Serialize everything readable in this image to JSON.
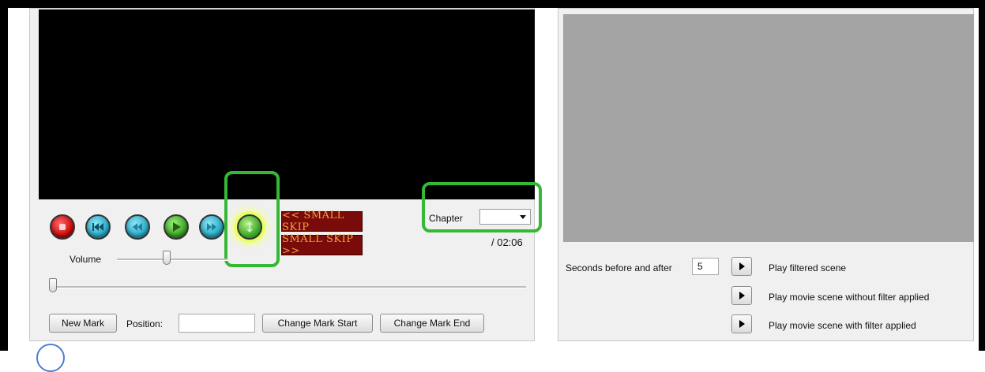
{
  "player": {
    "transport": {
      "stop_icon": "stop-icon",
      "previous_chapter_icon": "previous-chapter-icon",
      "rewind_icon": "rewind-icon",
      "play_icon": "play-icon",
      "fast_forward_icon": "fast-forward-icon",
      "frame_step_icon": "frame-step-icon"
    },
    "small_skip_back_label": "<< SMALL SKIP",
    "small_skip_forward_label": "SMALL SKIP >>",
    "chapter_label": "Chapter",
    "chapter_value": "",
    "duration_text": "/ 02:06",
    "volume_label": "Volume",
    "volume_level": 0.45,
    "position_level": 0.0,
    "new_mark_label": "New Mark",
    "position_label": "Position:",
    "position_value": "",
    "change_mark_start_label": "Change Mark Start",
    "change_mark_end_label": "Change Mark End"
  },
  "scene_preview": {
    "seconds_label": "Seconds before and after",
    "seconds_value": "5",
    "play_filtered_label": "Play filtered scene",
    "play_without_filter_label": "Play movie scene without filter applied",
    "play_with_filter_label": "Play movie scene with filter applied"
  },
  "colors": {
    "highlight": "#35b935",
    "skip_background": "#7a0b0b",
    "skip_text": "#f3a23a",
    "preview_background": "#a4a4a4"
  }
}
